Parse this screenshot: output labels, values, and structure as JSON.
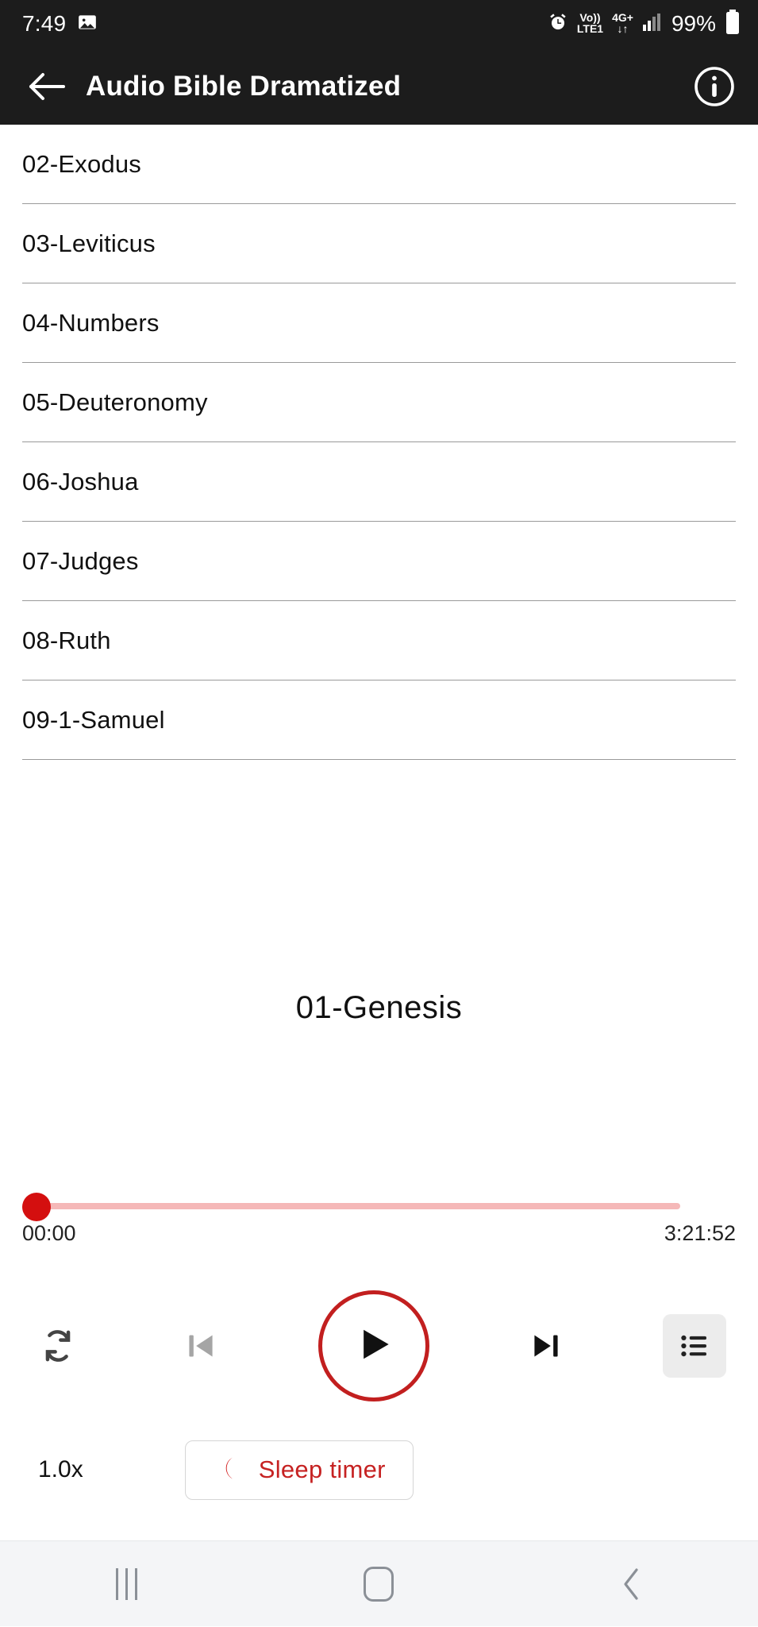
{
  "status_bar": {
    "time": "7:49",
    "gallery_icon": "image-icon",
    "alarm_icon": "alarm-icon",
    "volte_top": "Vo))",
    "volte_bottom": "LTE1",
    "network_top": "4G+",
    "network_bottom": "↓↑",
    "signal_icon": "signal-bars-icon",
    "battery_percent": "99%",
    "battery_icon": "battery-icon"
  },
  "app_bar": {
    "back_icon": "back-arrow-icon",
    "title": "Audio Bible Dramatized",
    "info_icon": "info-icon"
  },
  "book_list": {
    "items": [
      {
        "label": "02-Exodus"
      },
      {
        "label": "03-Leviticus"
      },
      {
        "label": "04-Numbers"
      },
      {
        "label": "05-Deuteronomy"
      },
      {
        "label": "06-Joshua"
      },
      {
        "label": "07-Judges"
      },
      {
        "label": "08-Ruth"
      },
      {
        "label": "09-1-Samuel"
      }
    ]
  },
  "now_playing": {
    "title": "01-Genesis",
    "elapsed": "00:00",
    "duration": "3:21:52",
    "progress_percent": 0
  },
  "controls": {
    "repeat_icon": "repeat-icon",
    "previous_icon": "skip-previous-icon",
    "play_icon": "play-icon",
    "next_icon": "skip-next-icon",
    "queue_icon": "playlist-queue-icon"
  },
  "bottom_bar": {
    "speed_label": "1.0x",
    "sleep_timer_icon": "moon-icon",
    "sleep_timer_label": "Sleep timer"
  },
  "nav_bar": {
    "recents_icon": "recents-icon",
    "home_icon": "home-icon",
    "back_icon": "nav-back-icon"
  },
  "colors": {
    "accent_red": "#c62222",
    "thumb_red": "#d40f0f",
    "track_pink": "#f5b8b8",
    "bar_dark": "#1c1c1c"
  }
}
